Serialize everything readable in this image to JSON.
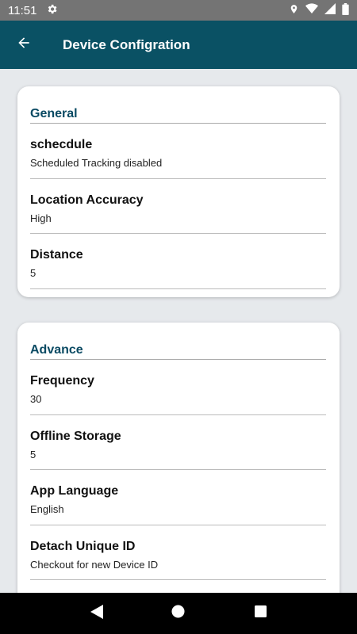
{
  "status_bar": {
    "time": "11:51",
    "icons": [
      "gear-icon",
      "location-icon",
      "wifi-icon",
      "signal-icon",
      "battery-icon"
    ]
  },
  "app_bar": {
    "title": "Device Configration",
    "back_icon": "arrow-back-icon"
  },
  "sections": [
    {
      "title": "General",
      "items": [
        {
          "title": "schecdule",
          "value": "Scheduled Tracking disabled"
        },
        {
          "title": "Location Accuracy",
          "value": "High"
        },
        {
          "title": "Distance",
          "value": "5"
        }
      ]
    },
    {
      "title": "Advance",
      "items": [
        {
          "title": "Frequency",
          "value": "30"
        },
        {
          "title": "Offline Storage",
          "value": "5"
        },
        {
          "title": "App Language",
          "value": "English"
        },
        {
          "title": "Detach Unique ID",
          "value": "Checkout for new Device ID"
        }
      ]
    }
  ],
  "nav_bar": {
    "icons": [
      "back-triangle-icon",
      "home-circle-icon",
      "recents-square-icon"
    ]
  },
  "colors": {
    "app_bar": "#0a5164",
    "section_title": "#0a4a63",
    "background": "#e6e9ec",
    "status_bar": "#747474"
  }
}
